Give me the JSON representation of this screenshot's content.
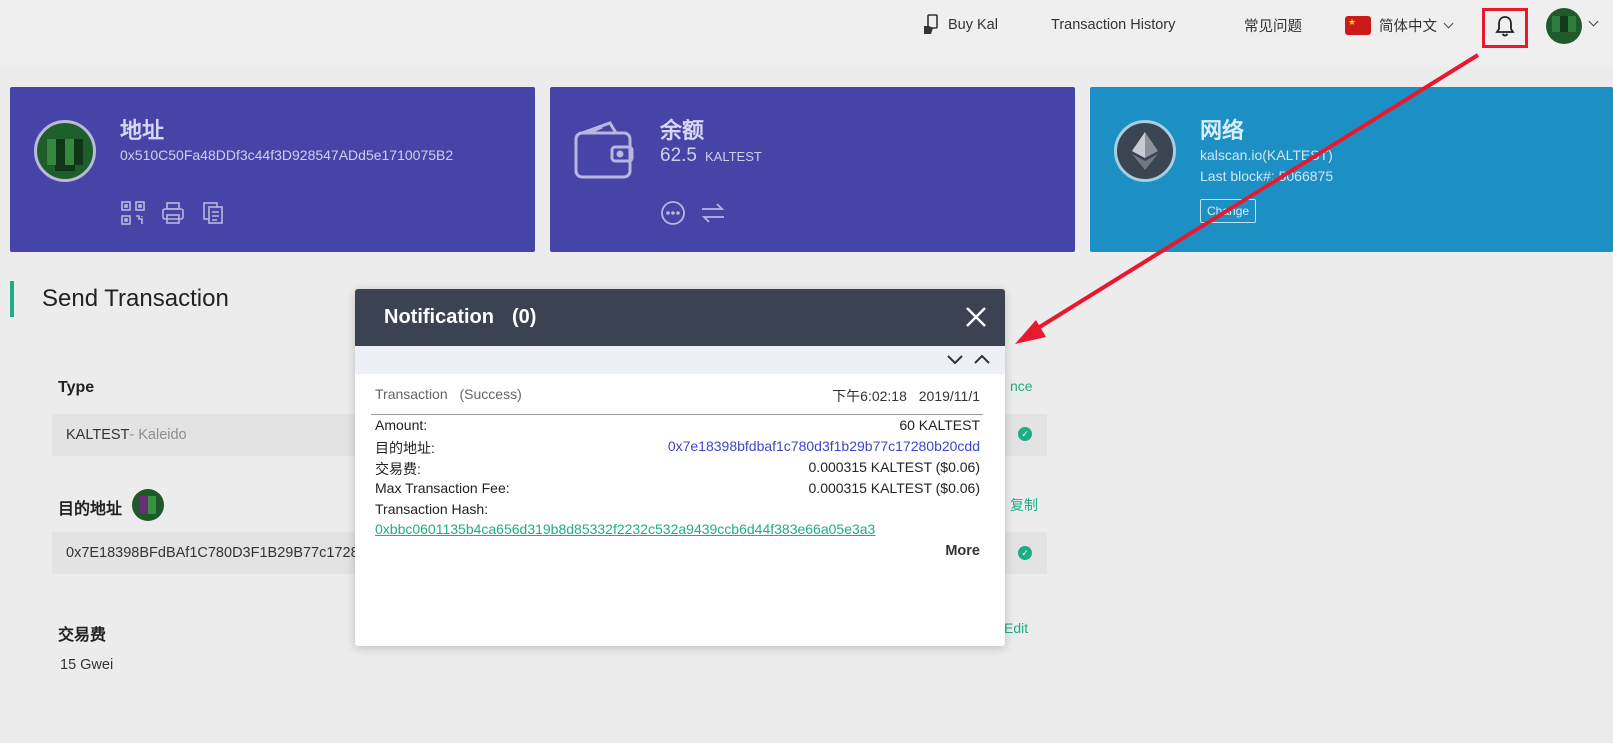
{
  "header": {
    "buy_label": "Buy Kal",
    "history_label": "Transaction History",
    "faq_label": "常见问题",
    "language_label": "简体中文"
  },
  "address_card": {
    "title": "地址",
    "address": "0x510C50Fa48DDf3c44f3D928547ADd5e1710075B2"
  },
  "balance_card": {
    "title": "余额",
    "amount": "62.5",
    "unit": "KALTEST"
  },
  "network_card": {
    "title": "网络",
    "network": "kalscan.io(KALTEST)",
    "last_block": "Last block#: 5066875",
    "change_label": "Change"
  },
  "send": {
    "title": "Send Transaction",
    "type_label": "Type",
    "type_value": "KALTEST",
    "type_sub": " - Kaleido",
    "balance_link": "nce",
    "to_label": "目的地址",
    "to_value": "0x7E18398BFdBAf1C780D3F1B29B77c1728",
    "copy_link": "复制",
    "fee_label": "交易费",
    "fee_value": "15 Gwei",
    "edit_link": "Edit"
  },
  "notification": {
    "title": "Notification",
    "count": "(0)",
    "type": "Transaction",
    "status": "(Success)",
    "time": "下午6:02:18",
    "date": "2019/11/1",
    "amount_label": "Amount:",
    "amount_value": "60 KALTEST",
    "to_label": "目的地址:",
    "to_value": "0x7e18398bfdbaf1c780d3f1b29b77c17280b20cdd",
    "fee_label": "交易费:",
    "fee_value": "0.000315 KALTEST ($0.06)",
    "max_fee_label": "Max Transaction Fee:",
    "max_fee_value": "0.000315 KALTEST ($0.06)",
    "hash_label": "Transaction Hash:",
    "hash_value": "0xbbc0601135b4ca656d319b8d85332f2232c532a9439ccb6d44f383e66a05e3a3",
    "more_label": "More"
  },
  "colors": {
    "card_purple": "#4744a8",
    "card_blue": "#1c8fc4",
    "accent_green": "#1dae86",
    "modal_header": "#3b4252",
    "highlight_red": "#e8192c"
  },
  "icons": [
    "hand-card-icon",
    "flag-cn-icon",
    "bell-icon",
    "qr-code-icon",
    "print-icon",
    "copy-icon",
    "wallet-icon",
    "more-dots-icon",
    "transfer-icon",
    "ethereum-icon",
    "close-icon",
    "chevron-down-icon",
    "chevron-up-icon",
    "check-icon"
  ]
}
